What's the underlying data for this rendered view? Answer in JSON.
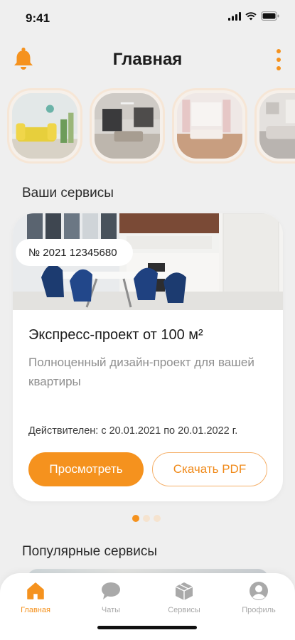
{
  "status_bar": {
    "time": "9:41"
  },
  "header": {
    "title": "Главная"
  },
  "stories": [
    {
      "name": "story-yellow-sofa"
    },
    {
      "name": "story-open-kitchen"
    },
    {
      "name": "story-pink-living"
    },
    {
      "name": "story-bedroom"
    }
  ],
  "services": {
    "section_title": "Ваши сервисы",
    "card": {
      "order_number": "№ 2021 12345680",
      "title": "Экспресс-проект от 100 м²",
      "description": "Полноценный дизайн-проект для вашей квартиры",
      "validity": "Действителен: с 20.01.2021 по 20.01.2022 г.",
      "view_button": "Просмотреть",
      "download_button": "Скачать PDF"
    },
    "pagination": {
      "current": 1,
      "total": 3
    }
  },
  "popular": {
    "section_title": "Популярные сервисы"
  },
  "tabbar": {
    "home": "Главная",
    "chats": "Чаты",
    "services": "Сервисы",
    "profile": "Профиль"
  },
  "colors": {
    "accent": "#f5921e",
    "background": "#efefef",
    "muted_text": "#8e8e8e"
  },
  "icons": {
    "bell": "bell-icon",
    "more": "more-vertical-icon",
    "home": "home-icon",
    "chat": "chat-icon",
    "services": "box-icon",
    "profile": "profile-icon"
  }
}
